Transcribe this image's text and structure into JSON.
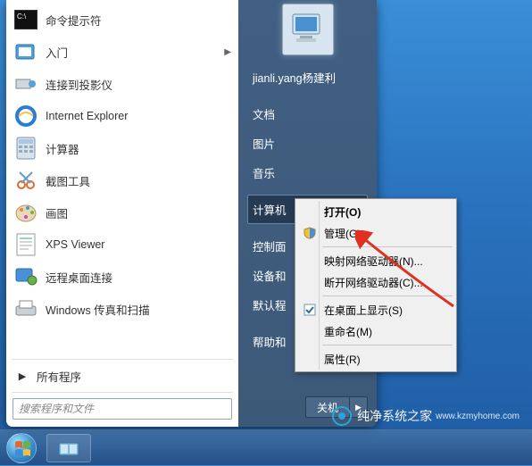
{
  "start_menu": {
    "programs": [
      {
        "label": "命令提示符",
        "icon": "cmd-icon",
        "has_submenu": false
      },
      {
        "label": "入门",
        "icon": "getting-started-icon",
        "has_submenu": true
      },
      {
        "label": "连接到投影仪",
        "icon": "projector-icon",
        "has_submenu": false
      },
      {
        "label": "Internet Explorer",
        "icon": "ie-icon",
        "has_submenu": false
      },
      {
        "label": "计算器",
        "icon": "calculator-icon",
        "has_submenu": false
      },
      {
        "label": "截图工具",
        "icon": "snipping-icon",
        "has_submenu": false
      },
      {
        "label": "画图",
        "icon": "paint-icon",
        "has_submenu": false
      },
      {
        "label": "XPS Viewer",
        "icon": "xps-icon",
        "has_submenu": false
      },
      {
        "label": "远程桌面连接",
        "icon": "rdp-icon",
        "has_submenu": false
      },
      {
        "label": "Windows 传真和扫描",
        "icon": "fax-icon",
        "has_submenu": false
      }
    ],
    "all_programs_label": "所有程序",
    "search_placeholder": "搜索程序和文件",
    "right_panel": {
      "username": "jianli.yang杨建利",
      "items_top": [
        "文档",
        "图片",
        "音乐"
      ],
      "computer_label": "计算机",
      "items_mid": [
        "控制面",
        "设备和",
        "默认程"
      ],
      "help_label": "帮助和"
    },
    "shutdown_label": "关机"
  },
  "context_menu": {
    "items": [
      {
        "label": "打开(O)",
        "bold": true,
        "icon": null
      },
      {
        "label": "管理(G)",
        "bold": false,
        "icon": "shield-icon"
      },
      {
        "sep": true
      },
      {
        "label": "映射网络驱动器(N)...",
        "bold": false,
        "icon": null
      },
      {
        "label": "断开网络驱动器(C)...",
        "bold": false,
        "icon": null
      },
      {
        "sep": true
      },
      {
        "label": "在桌面上显示(S)",
        "bold": false,
        "icon": "check-icon"
      },
      {
        "label": "重命名(M)",
        "bold": false,
        "icon": null
      },
      {
        "sep": true
      },
      {
        "label": "属性(R)",
        "bold": false,
        "icon": null
      }
    ]
  },
  "watermark": {
    "text": "纯净系统之家",
    "sub": "www.kzmyhome.com"
  }
}
